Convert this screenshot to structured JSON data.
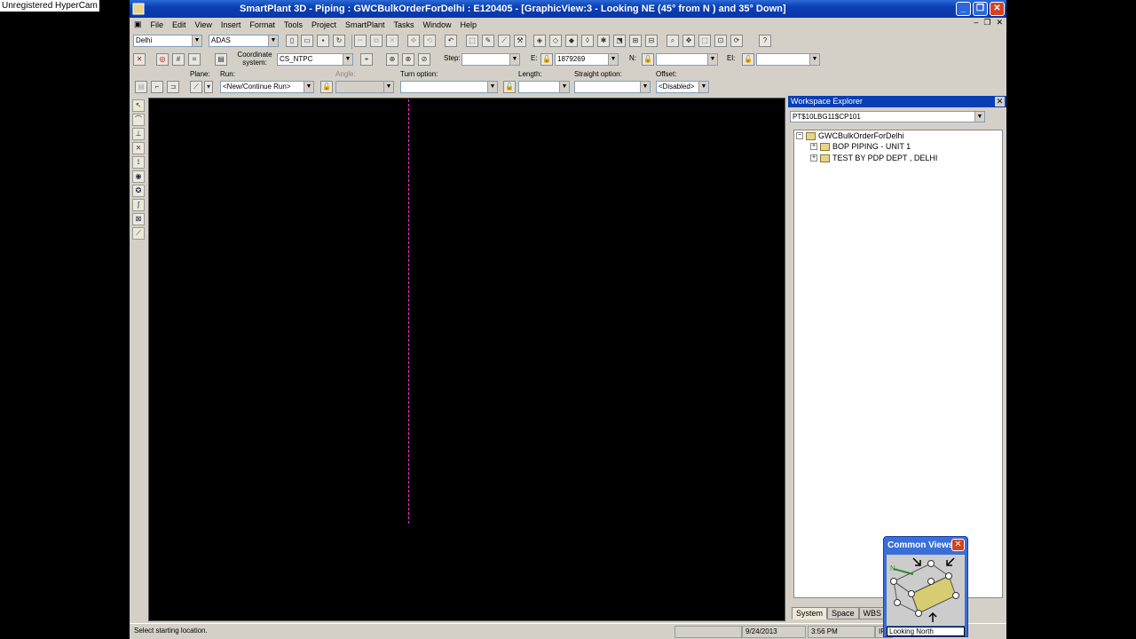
{
  "watermark": "Unregistered HyperCam",
  "window": {
    "title": "SmartPlant 3D - Piping : GWCBulkOrderForDelhi : E120405 - [GraphicView:3 - Looking NE (45° from N ) and 35° Down]"
  },
  "menu": [
    "File",
    "Edit",
    "View",
    "Insert",
    "Format",
    "Tools",
    "Project",
    "SmartPlant",
    "Tasks",
    "Window",
    "Help"
  ],
  "toolbar": {
    "location_value": "Delhi",
    "user_value": "ADAS",
    "coord_label": "Coordinate system:",
    "coord_value": "CS_NTPC",
    "step_label": "Step:",
    "e_label": "E:",
    "e_value": "1879269",
    "n_label": "N:",
    "el_label": "El:",
    "plane_label": "Plane:",
    "run_label": "Run:",
    "run_value": "<New/Continue Run>",
    "angle_label": "Angle:",
    "turn_label": "Turn option:",
    "length_label": "Length:",
    "straight_label": "Straight option:",
    "offset_label": "Offset:",
    "offset_value": "<Disabled>"
  },
  "workspace": {
    "title": "Workspace Explorer",
    "combo_value": "PT$10LBG11$CP101",
    "root": "GWCBulkOrderForDelhi",
    "children": [
      "BOP PIPING - UNIT 1",
      "TEST BY PDP DEPT , DELHI"
    ],
    "tabs": [
      "System",
      "Space",
      "WBS"
    ]
  },
  "common_views": {
    "title": "Common Views",
    "north": "N",
    "footer": "Looking North"
  },
  "status": {
    "message": "Select starting location.",
    "date": "9/24/2013",
    "time": "3:56 PM",
    "extra": "IF"
  }
}
